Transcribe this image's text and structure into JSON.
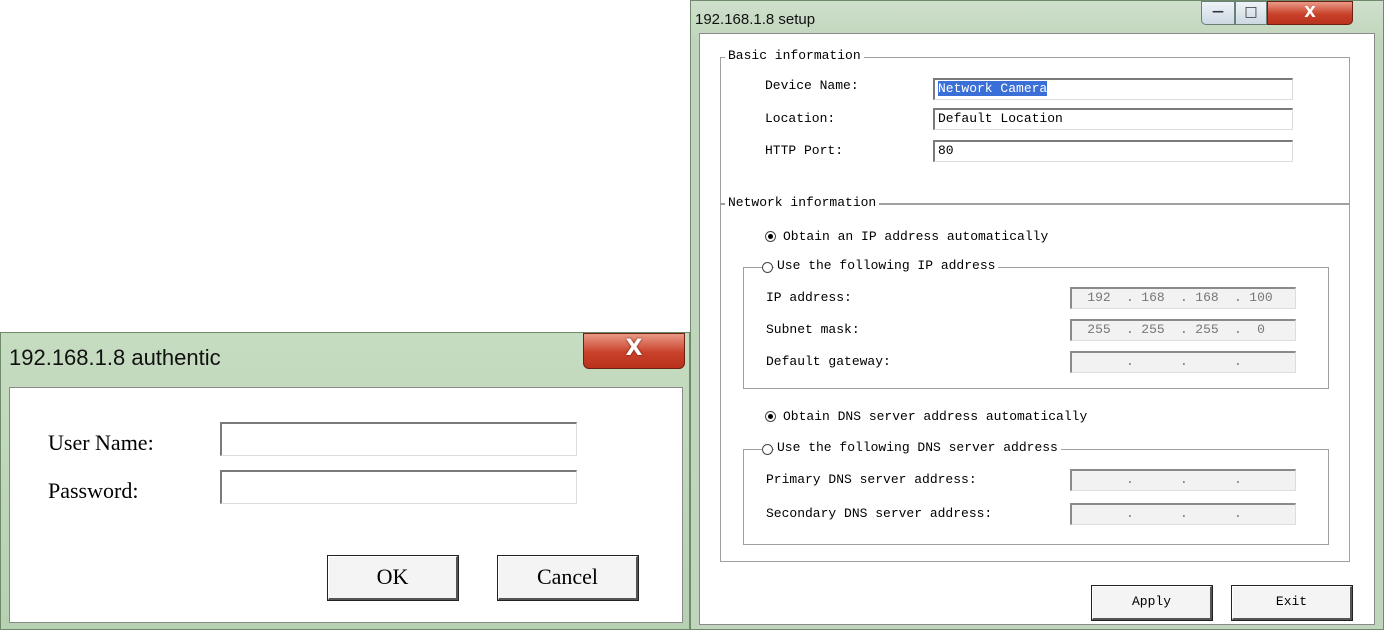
{
  "auth_dialog": {
    "title": "192.168.1.8 authentic",
    "close_glyph": "X",
    "username_label": "User Name:",
    "username_value": "",
    "password_label": "Password:",
    "password_value": "",
    "ok_label": "OK",
    "cancel_label": "Cancel"
  },
  "setup_dialog": {
    "title": "192.168.1.8 setup",
    "minimize_glyph": "—",
    "maximize_glyph": "□",
    "close_glyph": "X",
    "basic": {
      "legend": "Basic information",
      "device_name_label": "Device Name:",
      "device_name_value": "Network Camera",
      "location_label": "Location:",
      "location_value": "Default Location",
      "http_port_label": "HTTP Port:",
      "http_port_value": "80"
    },
    "network": {
      "legend": "Network information",
      "ip_auto_label": "Obtain an IP address automatically",
      "ip_manual_label": "Use the following IP address",
      "ip_address_label": "IP address:",
      "ip_address": [
        "192",
        "168",
        "168",
        "100"
      ],
      "subnet_label": "Subnet mask:",
      "subnet": [
        "255",
        "255",
        "255",
        "0"
      ],
      "gateway_label": "Default gateway:",
      "gateway": [
        "",
        "",
        "",
        ""
      ],
      "dns_auto_label": "Obtain DNS server address automatically",
      "dns_manual_label": "Use the following DNS server address",
      "primary_dns_label": "Primary DNS server address:",
      "primary_dns": [
        "",
        "",
        "",
        ""
      ],
      "secondary_dns_label": "Secondary DNS server address:",
      "secondary_dns": [
        "",
        "",
        "",
        ""
      ],
      "ip_mode": "automatic",
      "dns_mode": "automatic"
    },
    "apply_label": "Apply",
    "exit_label": "Exit"
  }
}
